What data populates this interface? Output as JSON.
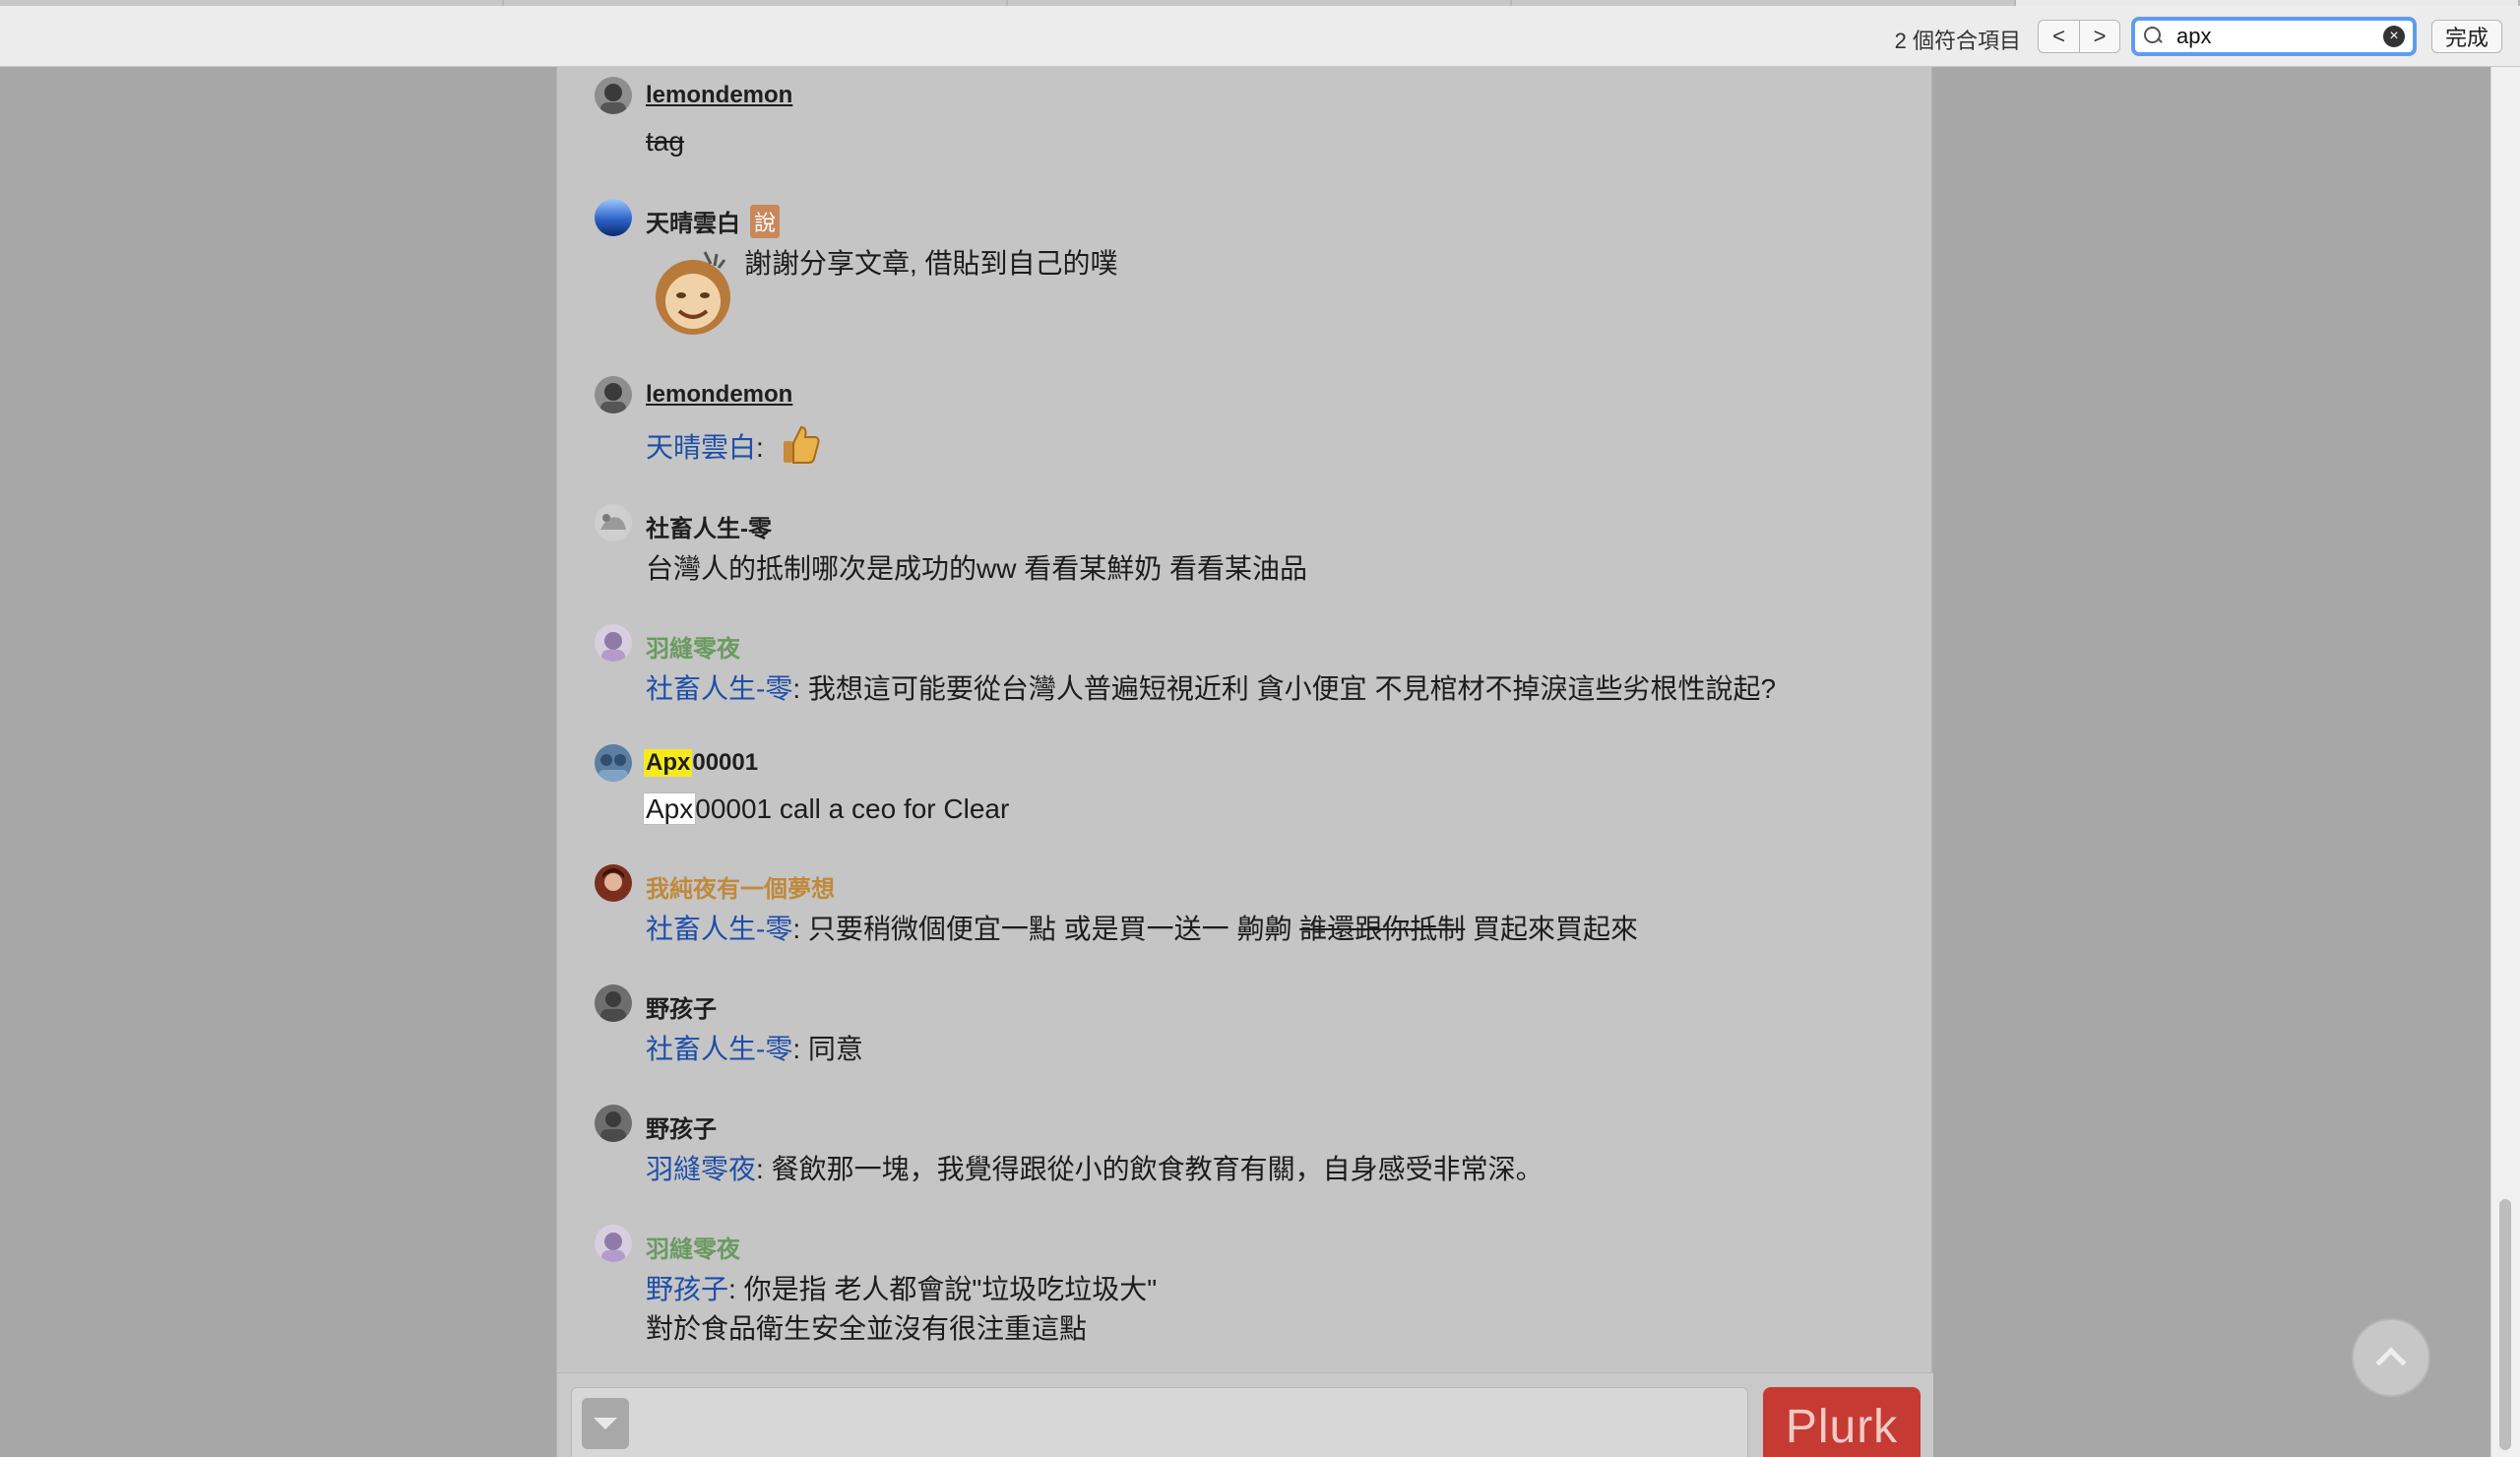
{
  "find_bar": {
    "match_count": "2 個符合項目",
    "prev_label": "<",
    "next_label": ">",
    "query": "apx",
    "clear_label": "×",
    "done_label": "完成"
  },
  "responses": [
    {
      "user": "lemondemon",
      "body": "tag"
    },
    {
      "user": "天晴雲白",
      "qualifier": "說",
      "body": "謝謝分享文章, 借貼到自己的噗"
    },
    {
      "user": "lemondemon",
      "mention": "天晴雲白",
      "body": ":"
    },
    {
      "user": "社畜人生-零",
      "body": "台灣人的抵制哪次是成功的ww 看看某鮮奶 看看某油品"
    },
    {
      "user": "羽縫零夜",
      "mention": "社畜人生-零",
      "body": ": 我想這可能要從台灣人普遍短視近利 貪小便宜 不見棺材不掉淚這些劣根性說起?"
    },
    {
      "user_highlight": "Apx",
      "user_rest": "00001",
      "body_highlight": "Apx",
      "body_rest": "00001 call a ceo for Clear"
    },
    {
      "user": "我純夜有一個夢想",
      "mention": "社畜人生-零",
      "body": ": 只要稍微個便宜一點 或是買一送一 齁齁 ",
      "body_strike": "誰還跟你抵制",
      "body_after": " 買起來買起來"
    },
    {
      "user": "野孩子",
      "mention": "社畜人生-零",
      "body": ": 同意"
    },
    {
      "user": "野孩子",
      "mention": "羽縫零夜",
      "body": ": 餐飲那一塊，我覺得跟從小的飲食教育有關，自身感受非常深。"
    },
    {
      "user": "羽縫零夜",
      "mention": "野孩子",
      "body": ": 你是指 老人都會說\"垃圾吃垃圾大\"",
      "body_line2": "對於食品衛生安全並沒有很注重這點"
    }
  ],
  "composer": {
    "submit_label": "Plurk"
  }
}
